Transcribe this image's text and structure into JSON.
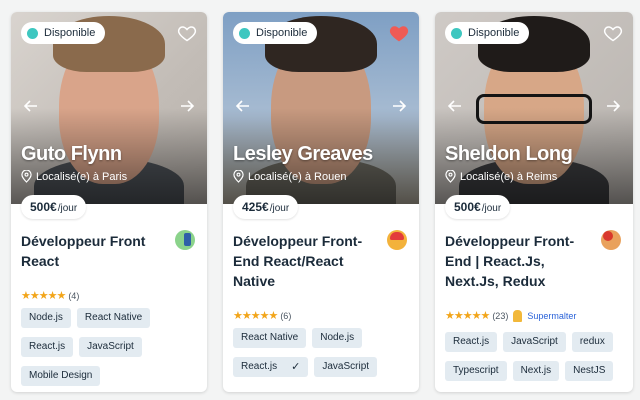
{
  "colors": {
    "available_dot": "#3ec7c0",
    "heart_active": "#ef5b55",
    "stars": "#f2a51a",
    "supermalter": "#2b63d9",
    "tag_bg": "#e3ebf1"
  },
  "cards": [
    {
      "available_label": "Disponible",
      "favorite": false,
      "name": "Guto Flynn",
      "location": "Localisé(e) à Paris",
      "price": "500€",
      "price_unit": "/jour",
      "title": "Développeur Front React",
      "emoji": "phone-emoji",
      "stars": "★★★★★",
      "rating_count": "(4)",
      "supermalter": "",
      "skills": [
        "Node.js",
        "React Native",
        "React.js",
        "JavaScript",
        "Mobile Design"
      ]
    },
    {
      "available_label": "Disponible",
      "favorite": true,
      "name": "Lesley Greaves",
      "location": "Localisé(e) à Rouen",
      "price": "425€",
      "price_unit": "/jour",
      "title": "Développeur Front-End React/React Native",
      "emoji": "baby-emoji",
      "stars": "★★★★★",
      "rating_count": "(6)",
      "supermalter": "",
      "skills": [
        "React Native",
        "Node.js",
        "React.js",
        "JavaScript"
      ],
      "checked_skill": "✓"
    },
    {
      "available_label": "Disponible",
      "favorite": false,
      "name": "Sheldon Long",
      "location": "Localisé(e) à Reims",
      "price": "500€",
      "price_unit": "/jour",
      "title": "Développeur Front-End | React.Js, Next.Js, Redux",
      "emoji": "superhero-emoji",
      "stars": "★★★★★",
      "rating_count": "(23)",
      "supermalter": "Supermalter",
      "skills": [
        "React.js",
        "JavaScript",
        "redux",
        "Typescript",
        "Next.js",
        "NestJS"
      ]
    }
  ]
}
